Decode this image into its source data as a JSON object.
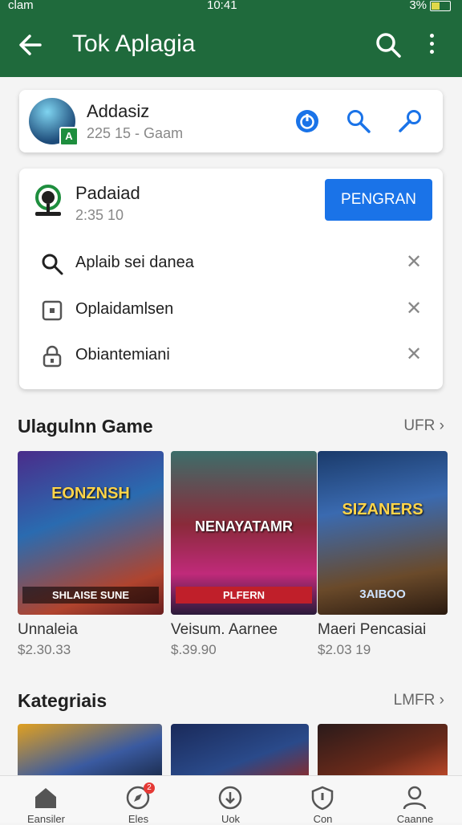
{
  "status_bar": {
    "carrier": "clam",
    "time": "10:41",
    "battery": "3%"
  },
  "app_bar": {
    "title": "Tok Aplagia"
  },
  "account": {
    "name": "Addasiz",
    "subtitle": "225 15 - Gaam",
    "badge": "A"
  },
  "dropdown": {
    "title": "Padaiad",
    "subtitle": "2:35 10",
    "button_label": "PENGRAN",
    "items": [
      {
        "label": "Aplaib sei danea",
        "icon": "search-icon"
      },
      {
        "label": "Oplaidamlsen",
        "icon": "square-icon"
      },
      {
        "label": "Obiantemiani",
        "icon": "lock-icon"
      }
    ]
  },
  "games_section": {
    "title": "Ulagulnn Game",
    "more_label": "UFR",
    "games": [
      {
        "name": "Unnaleia",
        "price": "$2.30.33",
        "art_title": "EONZNSH",
        "art_caption": "SHLAISE SUNE"
      },
      {
        "name": "Veisum. Aarnee",
        "price": "$.39.90",
        "art_title": "NENAYATAMR",
        "art_caption": "PLFERN"
      },
      {
        "name": "Maeri Pencasiai",
        "price": "$2.03 19",
        "art_title": "SIZANERS",
        "art_caption": "3AIBOO"
      }
    ]
  },
  "categories_section": {
    "title": "Kategriais",
    "more_label": "LMFR"
  },
  "bottom_nav": [
    {
      "label": "Eansiler",
      "icon": "home-icon"
    },
    {
      "label": "Eles",
      "icon": "compass-icon",
      "badge": "2"
    },
    {
      "label": "Uok",
      "icon": "download-icon"
    },
    {
      "label": "Con",
      "icon": "shield-icon"
    },
    {
      "label": "Caanne",
      "icon": "person-icon"
    }
  ],
  "colors": {
    "app_bar": "#1f6a3c",
    "accent": "#1a73e8",
    "badge_green": "#1e8e3e"
  }
}
